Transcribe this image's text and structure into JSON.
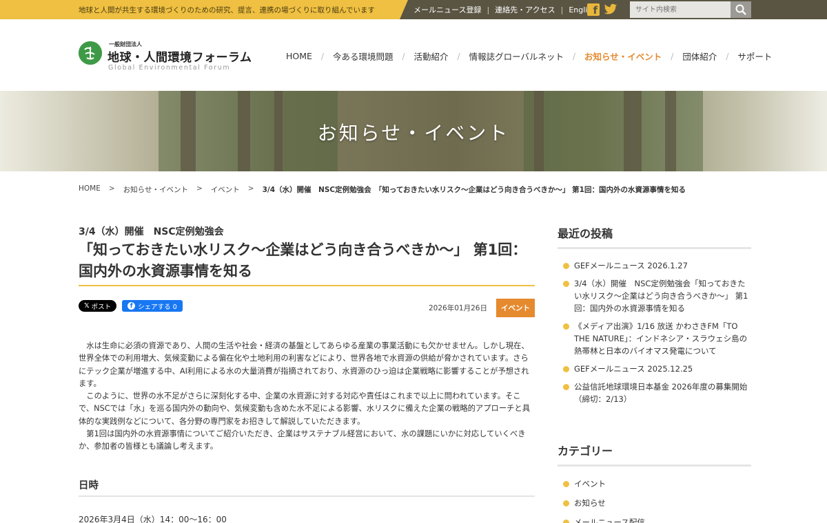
{
  "topbar": {
    "tagline": "地球と人間が共生する環境づくりのための研究、提言、連携の場づくりに取り組んでいます",
    "links": [
      "メールニュース登録",
      "連絡先・アクセス",
      "English"
    ],
    "search_placeholder": "サイト内検索"
  },
  "logo": {
    "org_kind": "一般財団法人",
    "org_name": "地球・人間環境フォーラム",
    "org_en": "Global Environmental Forum"
  },
  "nav": [
    "HOME",
    "今ある環境問題",
    "活動紹介",
    "情報誌グローバルネット",
    "お知らせ・イベント",
    "団体紹介",
    "サポート"
  ],
  "nav_active": "お知らせ・イベント",
  "hero": {
    "title": "お知らせ・イベント"
  },
  "breadcrumb": {
    "items": [
      "HOME",
      "お知らせ・イベント",
      "イベント"
    ],
    "current": "3/4（水）開催　NSC定例勉強会　「知っておきたい水リスク〜企業はどう向き合うべきか〜」 第1回：国内外の水資源事情を知る"
  },
  "article": {
    "subtitle": "3/4（水）開催　NSC定例勉強会",
    "title": "「知っておきたい水リスク〜企業はどう向き合うべきか〜」 第1回：国内外の水資源事情を知る",
    "share_x": "ポスト",
    "share_fb": "シェアする 0",
    "date": "2026年01月26日",
    "category": "イベント",
    "paragraphs": [
      "水は生命に必須の資源であり、人間の生活や社会・経済の基盤としてあらゆる産業の事業活動にも欠かせません。しかし現在、世界全体での利用増大、気候変動による偏在化や土地利用の利害などにより、世界各地で水資源の供給が脅かされています。さらにテック企業が増進する中、AI利用による水の大量消費が指摘されており、水資源のひっ迫は企業戦略に影響することが予想されます。",
      "このように、世界の水不足がさらに深刻化する中、企業の水資源に対する対応や責任はこれまで以上に問われています。そこで、NSCでは「水」を巡る国内外の動向や、気候変動も含めた水不足による影響、水リスクに備えた企業の戦略的アプローチと具体的な実践例などについて、各分野の専門家をお招きして解説していただきます。",
      "第1回は国内外の水資源事情についてご紹介いただき、企業はサステナブル経営において、水の課題にいかに対応していくべきか、参加者の皆様とも議論し考えます。"
    ],
    "section_heading": "日時",
    "datetime": "2026年3月4日（水）14：00〜16：00"
  },
  "sidebar": {
    "recent_heading": "最近の投稿",
    "recent": [
      "GEFメールニュース 2026.1.27",
      "3/4（水）開催　NSC定例勉強会「知っておきたい水リスク〜企業はどう向き合うべきか〜」 第1回：国内外の水資源事情を知る",
      "《メディア出演》1/16 放送 かわさきFM「TO THE NATURE」：インドネシア・スラウェシ島の熱帯林と日本のバイオマス発電について",
      "GEFメールニュース 2025.12.25",
      "公益信託地球環境日本基金 2026年度の募集開始（締切：2/13）"
    ],
    "category_heading": "カテゴリー",
    "categories": [
      "イベント",
      "お知らせ",
      "メールニュース配信"
    ]
  },
  "colors": {
    "accent_yellow": "#efc041",
    "accent_orange": "#e58a2e",
    "topbar_dark": "#5a5443"
  }
}
